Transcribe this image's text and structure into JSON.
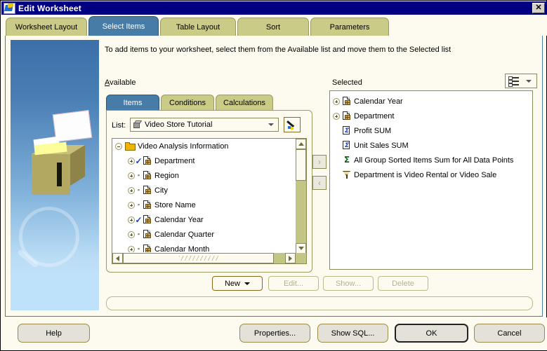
{
  "window": {
    "title": "Edit Worksheet",
    "close_label": "✕",
    "icon": "worksheet-icon"
  },
  "tabs": [
    {
      "label": "Worksheet Layout",
      "active": false
    },
    {
      "label": "Select Items",
      "active": true
    },
    {
      "label": "Table Layout",
      "active": false
    },
    {
      "label": "Sort",
      "active": false
    },
    {
      "label": "Parameters",
      "active": false
    }
  ],
  "instruction": "To add items to your worksheet, select them from the Available list and move them to the Selected list",
  "labels": {
    "available": "Available",
    "selected": "Selected",
    "list": "List:"
  },
  "view_button": {
    "icon": "list-view-icon",
    "chevron": "▾"
  },
  "inner_tabs": [
    {
      "label": "Items",
      "active": true
    },
    {
      "label": "Conditions",
      "active": false
    },
    {
      "label": "Calculations",
      "active": false
    }
  ],
  "list_combo": {
    "value": "Video Store Tutorial",
    "icon": "cube-icon"
  },
  "wand_button": {
    "icon": "wand-icon"
  },
  "available_tree": [
    {
      "label": "Video Analysis Information",
      "icon": "folder-icon",
      "level": 0,
      "expander": "minus",
      "checked": false
    },
    {
      "label": "Department",
      "icon": "item-icon",
      "level": 1,
      "expander": "plus",
      "checked": true
    },
    {
      "label": "Region",
      "icon": "item-icon",
      "level": 1,
      "expander": "plus",
      "checked": false
    },
    {
      "label": "City",
      "icon": "item-icon",
      "level": 1,
      "expander": "plus",
      "checked": false
    },
    {
      "label": "Store Name",
      "icon": "item-icon",
      "level": 1,
      "expander": "plus",
      "checked": false
    },
    {
      "label": "Calendar Year",
      "icon": "item-icon",
      "level": 1,
      "expander": "plus",
      "checked": true
    },
    {
      "label": "Calendar Quarter",
      "icon": "item-icon",
      "level": 1,
      "expander": "plus",
      "checked": false
    },
    {
      "label": "Calendar Month",
      "icon": "item-icon",
      "level": 1,
      "expander": "plus",
      "checked": false
    }
  ],
  "selected_tree": [
    {
      "label": "Calendar Year",
      "icon": "item-icon",
      "expander": "plus"
    },
    {
      "label": "Department",
      "icon": "item-icon",
      "expander": "plus"
    },
    {
      "label": "Profit SUM",
      "icon": "sum-item-icon",
      "expander": "none"
    },
    {
      "label": "Unit Sales SUM",
      "icon": "sum-item-icon",
      "expander": "none"
    },
    {
      "label": "All Group Sorted Items Sum for All Data Points",
      "icon": "sigma-icon",
      "expander": "none"
    },
    {
      "label": "Department is Video Rental or Video Sale",
      "icon": "funnel-icon",
      "expander": "none"
    }
  ],
  "transfer_buttons": [
    {
      "name": "move-right",
      "glyph": "›"
    },
    {
      "name": "move-left",
      "glyph": "‹"
    }
  ],
  "item_buttons": [
    {
      "label": "New",
      "enabled": true,
      "has_menu": true
    },
    {
      "label": "Edit...",
      "enabled": false,
      "has_menu": false
    },
    {
      "label": "Show...",
      "enabled": false,
      "has_menu": false
    },
    {
      "label": "Delete",
      "enabled": false,
      "has_menu": false
    }
  ],
  "status_field": {
    "value": ""
  },
  "footer_buttons": [
    {
      "label": "Help",
      "default": false
    },
    {
      "label": "Properties...",
      "default": false
    },
    {
      "label": "Show SQL...",
      "default": false
    },
    {
      "label": "OK",
      "default": true
    },
    {
      "label": "Cancel",
      "default": false
    }
  ],
  "colors": {
    "titlebar": "#000080",
    "tab_inactive": "#cacb86",
    "tab_active": "#477ca7",
    "panel_bg": "#fdfbef",
    "scrollbar_track": "#c3c585",
    "check": "#1c3fbf"
  }
}
